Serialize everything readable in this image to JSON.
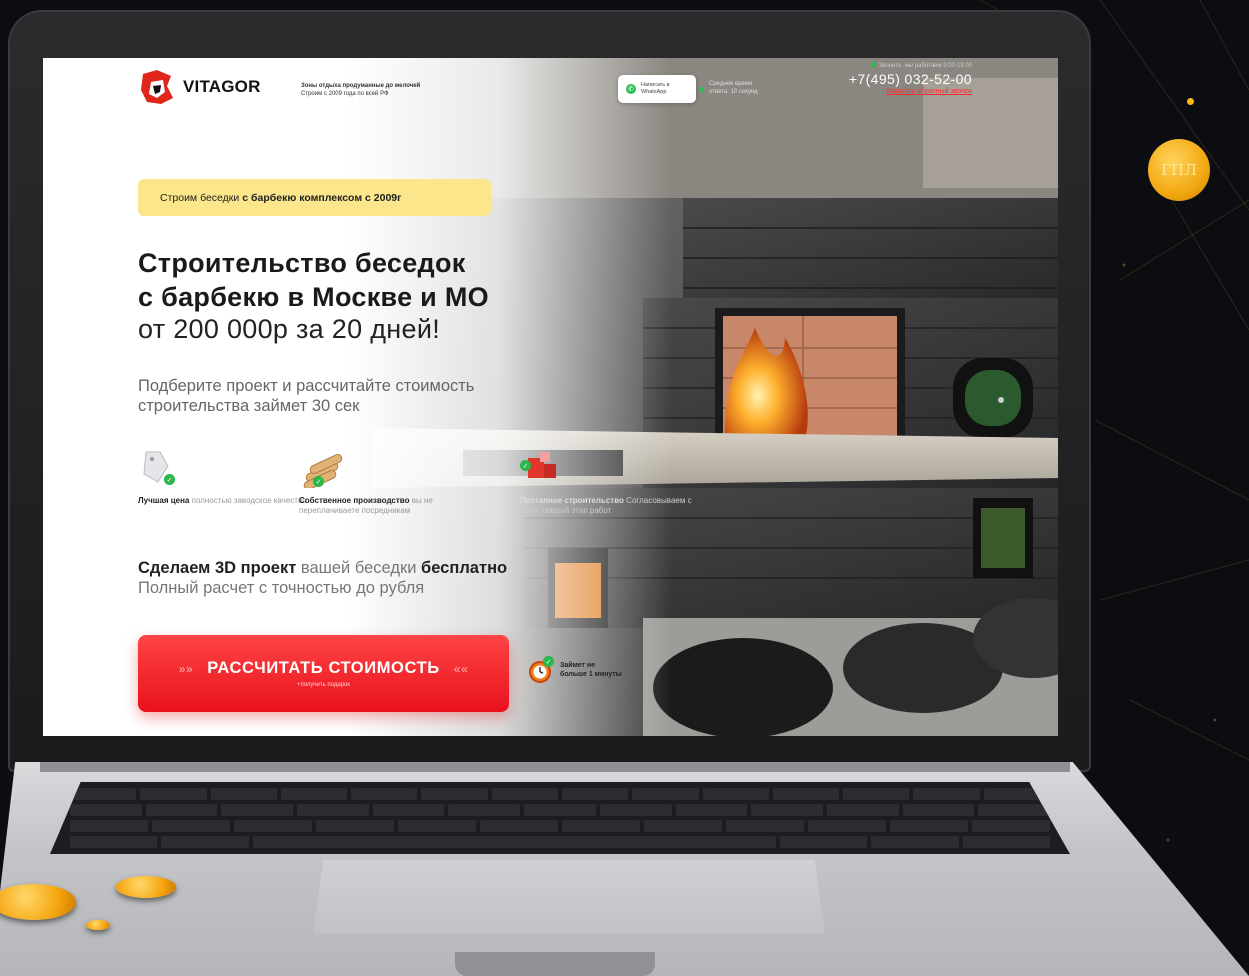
{
  "site": {
    "brand": "VITAGOR",
    "tagline_line1": "Зоны отдыха продуманные до мелочей",
    "tagline_line2": "Строим с 2009 года по всей РФ",
    "whatsapp_line1": "Написать в",
    "whatsapp_line2": "WhatsApp",
    "response_line1": "Среднее время",
    "response_line2": "ответа: 10 секунд",
    "hours": "Звоните, мы работаем 9:00-19:00",
    "phone": "+7(495) 032-52-00",
    "callback": "Заказать обратный звонок",
    "promo_badge_prefix": "Строим беседки",
    "promo_badge_bold": "с барбекю комплексом с 2009г",
    "headline_line1": "Строительство беседок",
    "headline_line2": "с барбекю в Москве и МО",
    "headline_sub": "от 200 000р за 20 дней!",
    "lead_line1": "Подберите проект и рассчитайте стоимость",
    "lead_line2": "строительства займет 30 сек",
    "features": [
      {
        "title": "Лучшая цена",
        "desc": "полностью заводское качество",
        "icon": "price-tag-icon"
      },
      {
        "title": "Собственное производство",
        "desc": "вы не переплачиваете посредникам",
        "icon": "lumber-icon"
      },
      {
        "title": "Поэтапное строительство",
        "desc": "Согласовываем с вами каждый этап работ",
        "icon": "construction-icon"
      }
    ],
    "offer_bold1": "Сделаем 3D проект",
    "offer_mid": "вашей беседки",
    "offer_bold2": "бесплатно",
    "offer_line2": "Полный расчет с точностью до рубля",
    "cta_label": "РАССЧИТАТЬ СТОИМОСТЬ",
    "cta_sub": "+получить подарок",
    "timer_line1": "Займет не",
    "timer_line2": "больше 1 минуты"
  },
  "decor": {
    "coin_text": "ГПЛ",
    "accent": "#e8111d",
    "badge_yellow": "#fbe68b",
    "whatsapp_green": "#2bbf4c"
  }
}
